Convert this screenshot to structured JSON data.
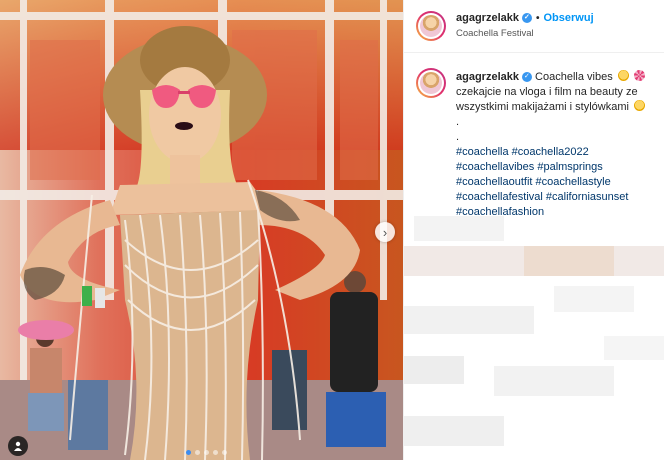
{
  "post": {
    "username": "agagrzelakk",
    "follow_label": "Obserwuj",
    "location": "Coachella Festival",
    "caption_text_1": "Coachella vibes",
    "caption_text_2": "czekajcie na vloga i film na beauty ze wszystkimi makijażami i stylówkami",
    "caption_dot_1": ".",
    "caption_dot_2": ".",
    "hashtags": [
      "#coachella",
      "#coachella2022",
      "#coachellavibes",
      "#palmsprings",
      "#coachellaoutfit",
      "#coachellastyle",
      "#coachellafestival",
      "#californiasunset",
      "#coachellafashion"
    ]
  },
  "carousel": {
    "slide_count": 5,
    "active_index": 0
  },
  "icons": {
    "verified": "verified-badge-icon",
    "next": "chevron-right-icon",
    "tag": "user-tag-icon",
    "emoji_1": "heart-eyes-emoji-icon",
    "emoji_2": "disco-ball-emoji-icon",
    "emoji_3": "heart-eyes-emoji-icon"
  },
  "colors": {
    "accent": "#0095f6",
    "link": "#00376b",
    "verified": "#3897f0",
    "carousel_active": "#3b8cf0"
  }
}
